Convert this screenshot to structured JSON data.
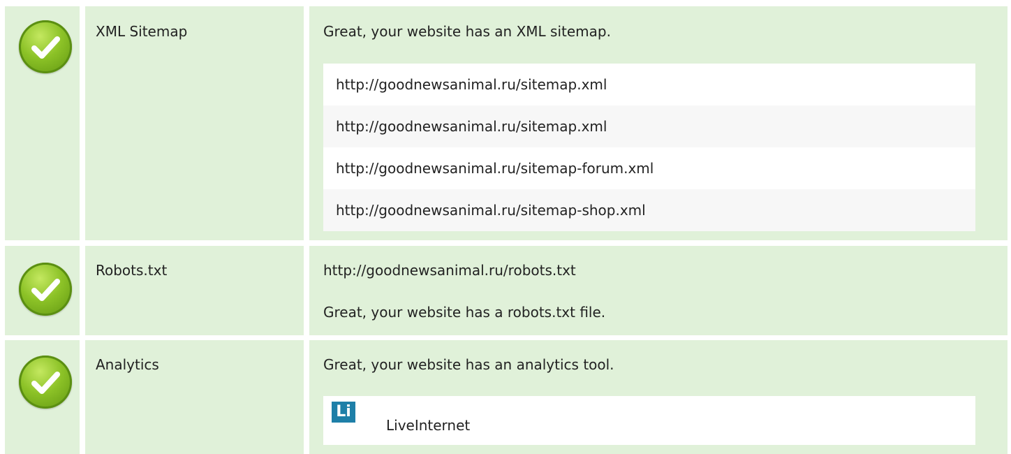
{
  "rows": [
    {
      "label": "XML Sitemap",
      "status_icon": "check-icon",
      "message": "Great, your website has an XML sitemap.",
      "sitemaps": [
        "http://goodnewsanimal.ru/sitemap.xml",
        "http://goodnewsanimal.ru/sitemap.xml",
        "http://goodnewsanimal.ru/sitemap-forum.xml",
        "http://goodnewsanimal.ru/sitemap-shop.xml"
      ]
    },
    {
      "label": "Robots.txt",
      "status_icon": "check-icon",
      "url": "http://goodnewsanimal.ru/robots.txt",
      "message": "Great, your website has a robots.txt file."
    },
    {
      "label": "Analytics",
      "status_icon": "check-icon",
      "message": "Great, your website has an analytics tool.",
      "tool": {
        "logo_text": "Li",
        "name": "LiveInternet",
        "logo_color": "#1e7fa8"
      }
    }
  ],
  "colors": {
    "row_background": "#e0f1d9",
    "check_green": "#8cc227"
  }
}
